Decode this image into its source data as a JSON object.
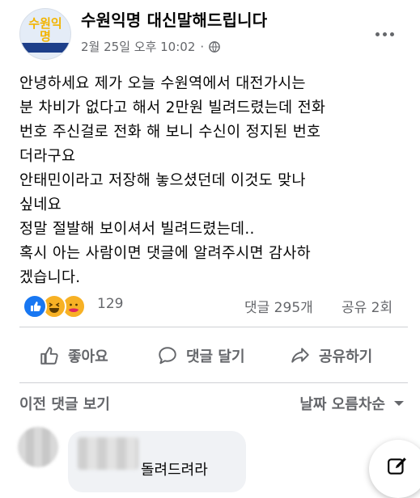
{
  "post": {
    "page_name": "수원익명 대신말해드립니다",
    "timestamp": "2월 25일 오후 10:02",
    "avatar_logo_text": "수원익명",
    "avatar_logo_caption": "대신 말해드립니다",
    "body_lines": [
      "안녕하세요 제가 오늘 수원역에서 대전가시는",
      "분 차비가 없다고 해서 2만원 빌려드렸는데 전화",
      "번호 주신걸로 전화 해 보니 수신이 정지된 번호",
      "더라구요",
      "안태민이라고 저장해 놓으셨던데 이것도 맞나",
      "싶네요",
      "정말 절발해 보이셔서 빌려드렸는데..",
      "혹시 아는 사람이면 댓글에 알려주시면 감사하",
      "겠습니다."
    ]
  },
  "engagement": {
    "reaction_count": "129",
    "comments": "댓글 295개",
    "shares": "공유 2회",
    "reactions": [
      "like-reaction-icon",
      "haha-reaction-icon",
      "care-reaction-icon"
    ]
  },
  "actions": {
    "like": "좋아요",
    "comment": "댓글 달기",
    "share": "공유하기"
  },
  "comments_section": {
    "view_previous": "이전 댓글 보기",
    "sort": "날짜 오름차순",
    "first_comment_text": "돌려드려라"
  },
  "colors": {
    "facebook_blue": "#1877f2",
    "secondary_text": "#65676b",
    "bubble_bg": "#f0f2f5"
  }
}
